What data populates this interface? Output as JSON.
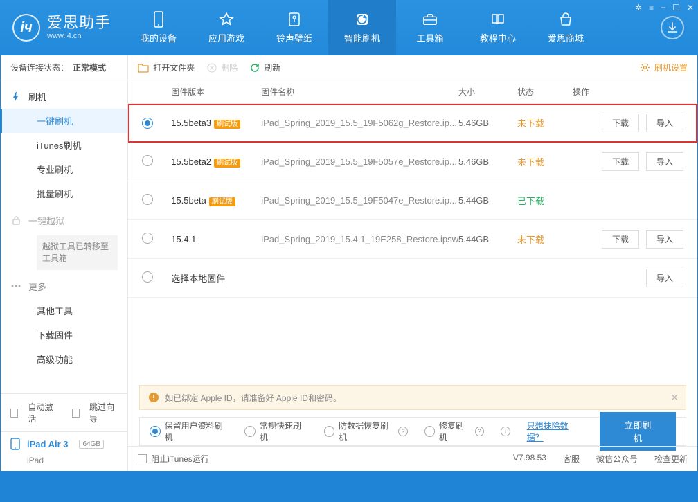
{
  "brand": "爱思助手",
  "url": "www.i4.cn",
  "win_controls": [
    "✲",
    "☰",
    "−",
    "☐",
    "✕"
  ],
  "nav": [
    {
      "id": "my-device",
      "label": "我的设备"
    },
    {
      "id": "apps-games",
      "label": "应用游戏"
    },
    {
      "id": "ringtones",
      "label": "铃声壁纸"
    },
    {
      "id": "smart-flash",
      "label": "智能刷机",
      "active": true
    },
    {
      "id": "toolbox",
      "label": "工具箱"
    },
    {
      "id": "tutorial",
      "label": "教程中心"
    },
    {
      "id": "store",
      "label": "爱思商城"
    }
  ],
  "status_prefix": "设备连接状态：",
  "status_value": "正常模式",
  "sidebar": {
    "flash": {
      "label": "刷机",
      "items": [
        {
          "id": "one-key",
          "label": "一键刷机",
          "active": true
        },
        {
          "id": "itunes",
          "label": "iTunes刷机"
        },
        {
          "id": "pro",
          "label": "专业刷机"
        },
        {
          "id": "batch",
          "label": "批量刷机"
        }
      ]
    },
    "jailbreak": {
      "label": "一键越狱",
      "note": "越狱工具已转移至工具箱"
    },
    "more": {
      "label": "更多",
      "items": [
        {
          "id": "other-tools",
          "label": "其他工具"
        },
        {
          "id": "dl-fw",
          "label": "下载固件"
        },
        {
          "id": "adv",
          "label": "高级功能"
        }
      ]
    }
  },
  "auto_activate": "自动激活",
  "skip_guide": "跳过向导",
  "device": {
    "name": "iPad Air 3",
    "capacity": "64GB",
    "model": "iPad"
  },
  "toolbar": {
    "open": "打开文件夹",
    "delete": "删除",
    "refresh": "刷新",
    "settings": "刷机设置"
  },
  "columns": {
    "ver": "固件版本",
    "name": "固件名称",
    "size": "大小",
    "status": "状态",
    "action": "操作"
  },
  "tag_beta": "刷试版",
  "btn": {
    "download": "下载",
    "import": "导入"
  },
  "status": {
    "no": "未下载",
    "yes": "已下载"
  },
  "firmware": [
    {
      "selected": true,
      "ver": "15.5beta3",
      "beta": true,
      "name": "iPad_Spring_2019_15.5_19F5062g_Restore.ip...",
      "size": "5.46GB",
      "status": "no",
      "dl": true,
      "imp": true,
      "highlight": true
    },
    {
      "selected": false,
      "ver": "15.5beta2",
      "beta": true,
      "name": "iPad_Spring_2019_15.5_19F5057e_Restore.ip...",
      "size": "5.46GB",
      "status": "no",
      "dl": true,
      "imp": true
    },
    {
      "selected": false,
      "ver": "15.5beta",
      "beta": true,
      "name": "iPad_Spring_2019_15.5_19F5047e_Restore.ip...",
      "size": "5.44GB",
      "status": "yes",
      "dl": false,
      "imp": false
    },
    {
      "selected": false,
      "ver": "15.4.1",
      "beta": false,
      "name": "iPad_Spring_2019_15.4.1_19E258_Restore.ipsw",
      "size": "5.44GB",
      "status": "no",
      "dl": true,
      "imp": true
    },
    {
      "selected": false,
      "ver": "选择本地固件",
      "beta": false,
      "name": "",
      "size": "",
      "status": "",
      "dl": false,
      "imp": true
    }
  ],
  "notice": "如已绑定 Apple ID，请准备好 Apple ID和密码。",
  "flash_options": [
    {
      "id": "keep",
      "label": "保留用户资料刷机",
      "sel": true
    },
    {
      "id": "quick",
      "label": "常规快速刷机",
      "sel": false
    },
    {
      "id": "recover",
      "label": "防数据恢复刷机",
      "sel": false,
      "help": true
    },
    {
      "id": "repair",
      "label": "修复刷机",
      "sel": false,
      "help": true
    }
  ],
  "erase_link": "只想抹除数据？",
  "flash_now": "立即刷机",
  "footer": {
    "block_itunes": "阻止iTunes运行",
    "version": "V7.98.53",
    "kefu": "客服",
    "wechat": "微信公众号",
    "check": "检查更新"
  }
}
